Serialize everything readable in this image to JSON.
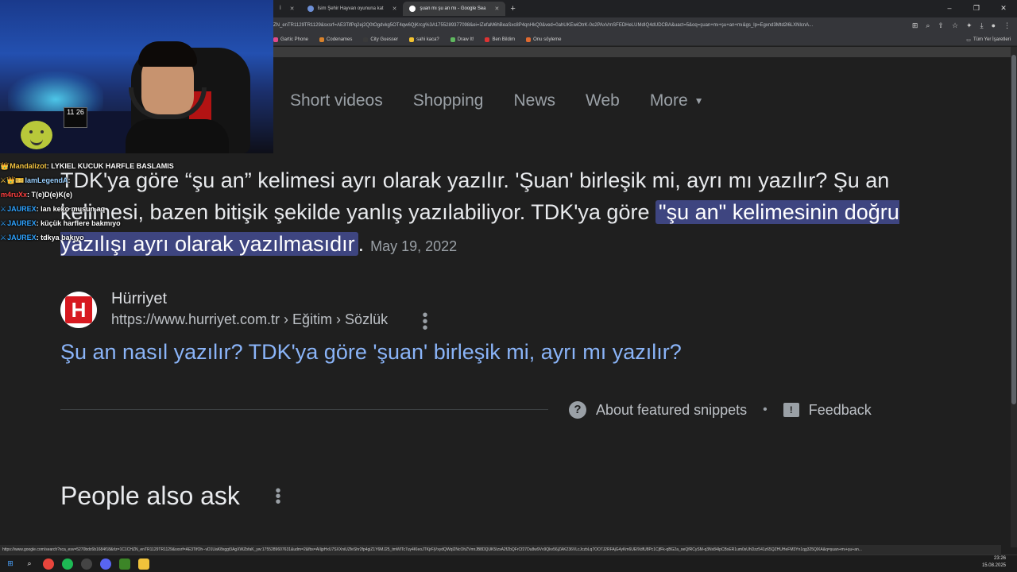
{
  "browser": {
    "tabs": [
      {
        "label": "İ",
        "active": false
      },
      {
        "label": "İsim Şehir Hayvan oyununa kat",
        "active": false
      },
      {
        "label": "şuan mı şu an mı - Google Sea",
        "active": true
      }
    ],
    "new_tab": "+",
    "url": "ZN_enTR1129TR1129&sxsrf=AE3TifPq2ej2Q0tOgdvkg5OT4qw6QjKrcg%3A1755289377098&ei=IZefaM6hBeaSxc8P4qnHkQ0&ved=0ahUKEwiOtrK-0o2PAxVmSFEDHeLUMdIQ4dUDCBA&uact=5&oq=şuan+mı+şu+an+mı&gs_lp=Egxnd3Mtd2l6LXNlcnA...",
    "bookmarks": [
      {
        "label": "Gartic Phone",
        "color": "#e04b8a"
      },
      {
        "label": "Codenames",
        "color": "#d9822b"
      },
      {
        "label": "City Guesser",
        "color": "#3a3a3a"
      },
      {
        "label": "sahi kaca?",
        "color": "#f2c230"
      },
      {
        "label": "Draw It!",
        "color": "#5fb85f"
      },
      {
        "label": "Ben Bildim",
        "color": "#d33"
      },
      {
        "label": "Onu söyleme",
        "color": "#e06a30"
      }
    ],
    "all_bookmarks": "Tüm Yer İşaretleri",
    "status_url": "https://www.google.com/search?sca_esv=5270bdc6b1684f18&rlz=1C1CHZN_enTR1129TR1129&sxsrf=AE3TifOh--vD1UaK8xggt3AgXWZbfaK_yw:1755289607631&udm=2&fbs=AIIjpHxU7SXXniUZfeShr2fp4giZ1Y6MJ25_tmWITc7uy4KIeoJTKjrFjVxydQWql2NcOhZVmrJB8DQUK5IzxA2fZbQFrCf27Du8w9Vv9Qkv56jZAK236VLcJczbLq7OO7J2RFAjG4yKm6UEfXdfU8Pc1CjfFk-qBG2a_oeQfRCySM-q3Nx84IpCBxER1um0sUhDzz541z65QZHUHeFM3Yn1qg325QlXA&q=şuan+mı+şu+an..."
  },
  "google": {
    "tabs": [
      {
        "label": "Short videos"
      },
      {
        "label": "Shopping"
      },
      {
        "label": "News"
      },
      {
        "label": "Web"
      },
      {
        "label": "More"
      }
    ],
    "snippet": {
      "text_before": "TDK'ya göre “şu an” kelimesi ayrı olarak yazılır. 'Şuan' birleşik mi, ayrı mı yazılır? Şu an kelimesi, bazen bitişik şekilde yanlış yazılabiliyor. TDK'ya göre ",
      "highlight": "\"şu an\" kelimesinin doğru yazılışı ayrı olarak yazılmasıdır",
      "text_after": ".",
      "date": "May 19, 2022"
    },
    "source": {
      "logo_letter": "H",
      "name": "Hürriyet",
      "url": "https://www.hurriyet.com.tr › Eğitim › Sözlük"
    },
    "result_title": "Şu an nasıl yazılır? TDK'ya göre 'şuan' birleşik mi, ayrı mı yazılır?",
    "about_snippets": "About featured snippets",
    "feedback": "Feedback",
    "people_also_ask": "People also ask"
  },
  "chat": [
    {
      "badge": "👑",
      "user": "Mandalizot",
      "user_color": "#f5c542",
      "msg": "LYKIEL KUCUK HARFLE BASLAMIS"
    },
    {
      "badge": "⚔👑🎫",
      "user": "IamLegendA",
      "user_color": "#9ad0ff",
      "msg": ""
    },
    {
      "badge": "",
      "user": "m4ruXx",
      "user_color": "#ff4040",
      "msg": "T(e)D(e)K(e)"
    },
    {
      "badge": "⚔",
      "user": "JAUREX",
      "user_color": "#2fa3ff",
      "msg": "lan keko musun aq"
    },
    {
      "badge": "⚔",
      "user": "JAUREX",
      "user_color": "#2fa3ff",
      "msg": "küçük harflere bakmıyo"
    },
    {
      "badge": "⚔",
      "user": "JAUREX",
      "user_color": "#2fa3ff",
      "msg": "tdkya bakıyo"
    }
  ],
  "webcam": {
    "monitor_text": "11 26"
  },
  "taskbar": {
    "time": "23:26",
    "date": "15.08.2025"
  }
}
